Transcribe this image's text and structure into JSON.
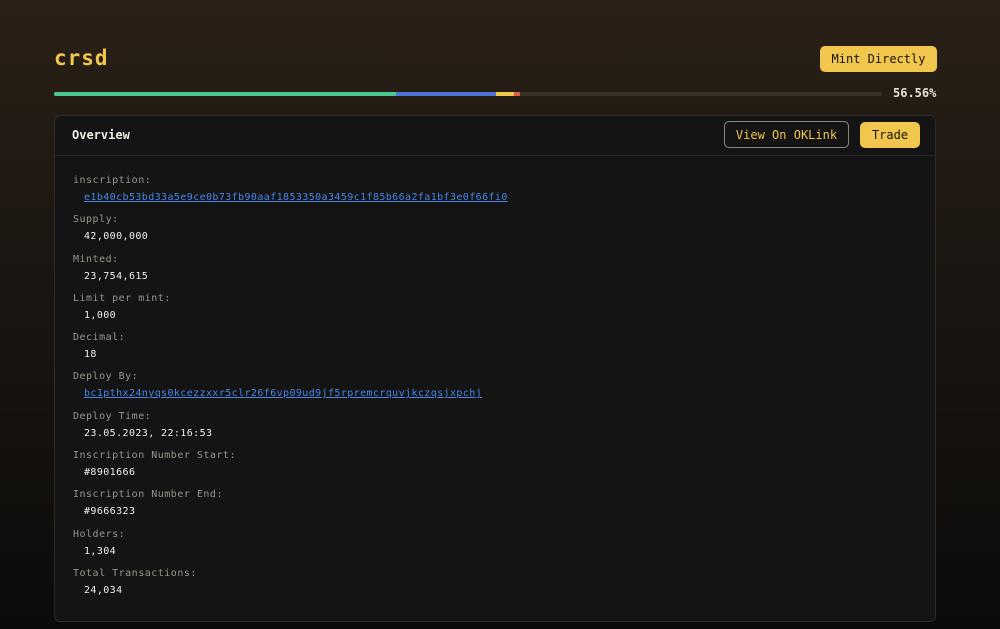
{
  "header": {
    "title": "crsd",
    "mint_label": "Mint Directly"
  },
  "progress": {
    "percent_label": "56.56%",
    "segments": [
      {
        "name": "green",
        "color": "#4cc990",
        "fraction": 0.413
      },
      {
        "name": "blue",
        "color": "#4f74d8",
        "fraction": 0.121
      },
      {
        "name": "yellow",
        "color": "#f0c64c",
        "fraction": 0.022
      },
      {
        "name": "red",
        "color": "#e06050",
        "fraction": 0.007
      }
    ]
  },
  "panel": {
    "title": "Overview",
    "oklink_label": "View On OKLink",
    "trade_label": "Trade",
    "fields": [
      {
        "label": "inscription:",
        "value": "e1b40cb53bd33a5e9ce0b73fb90aaf1853350a3459c1f85b66a2fa1bf3e0f66fi0",
        "link": true
      },
      {
        "label": "Supply:",
        "value": "42,000,000",
        "link": false
      },
      {
        "label": "Minted:",
        "value": "23,754,615",
        "link": false
      },
      {
        "label": "Limit per mint:",
        "value": "1,000",
        "link": false
      },
      {
        "label": "Decimal:",
        "value": "18",
        "link": false
      },
      {
        "label": "Deploy By:",
        "value": "bc1pthx24nyqs0kcezzxxr5clr26f6vp09ud9jf5rpremcrquvjkczqsjxpchj",
        "link": true
      },
      {
        "label": "Deploy Time:",
        "value": "23.05.2023, 22:16:53",
        "link": false
      },
      {
        "label": "Inscription Number Start:",
        "value": "#8901666",
        "link": false
      },
      {
        "label": "Inscription Number End:",
        "value": "#9666323",
        "link": false
      },
      {
        "label": "Holders:",
        "value": "1,304",
        "link": false
      },
      {
        "label": "Total Transactions:",
        "value": "24,034",
        "link": false
      }
    ]
  }
}
